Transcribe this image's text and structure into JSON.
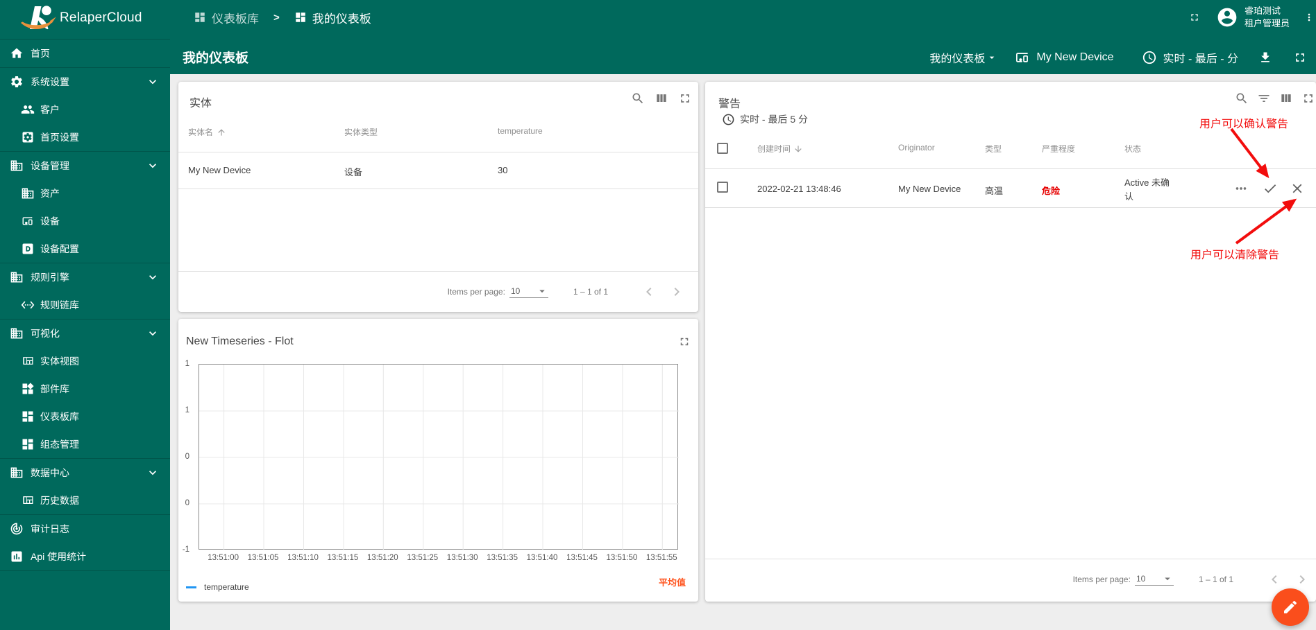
{
  "app": {
    "name": "RelaperCloud"
  },
  "colors": {
    "primary": "#00695C",
    "content_bg": "#EEEEEE",
    "fab_orange": "#FA4E1C",
    "annotation_red": "#F20D0D",
    "severity_red": "#E60000",
    "series_blue": "#2196F3",
    "avg_orange": "#FF5722"
  },
  "breadcrumb": {
    "separator": ">",
    "items": [
      {
        "label": "仪表板库"
      },
      {
        "label": "我的仪表板"
      }
    ]
  },
  "user": {
    "name": "睿珀测试",
    "role": "租户管理员"
  },
  "page_title": "我的仪表板",
  "toolbar": {
    "dashboard_select": "我的仪表板",
    "device_label": "My New Device",
    "timewindow": "实时 - 最后 - 分"
  },
  "sidebar": {
    "items": [
      {
        "label": "首页",
        "icon": "home"
      },
      {
        "label": "系统设置",
        "icon": "settings",
        "expandable": true
      },
      {
        "label": "客户",
        "icon": "people",
        "sub": true
      },
      {
        "label": "首页设置",
        "icon": "settings-applications",
        "sub": true
      },
      {
        "label": "设备管理",
        "icon": "domain",
        "expandable": true
      },
      {
        "label": "资产",
        "icon": "domain",
        "sub": true
      },
      {
        "label": "设备",
        "icon": "devices-other",
        "sub": true
      },
      {
        "label": "设备配置",
        "icon": "alpha-d-box",
        "sub": true
      },
      {
        "label": "规则引擎",
        "icon": "domain",
        "expandable": true
      },
      {
        "label": "规则链库",
        "icon": "settings-ethernet",
        "sub": true
      },
      {
        "label": "可视化",
        "icon": "domain",
        "expandable": true
      },
      {
        "label": "实体视图",
        "icon": "view-quilt",
        "sub": true
      },
      {
        "label": "部件库",
        "icon": "widgets",
        "sub": true
      },
      {
        "label": "仪表板库",
        "icon": "dashboard",
        "sub": true
      },
      {
        "label": "组态管理",
        "icon": "dashboard",
        "sub": true
      },
      {
        "label": "数据中心",
        "icon": "domain",
        "expandable": true
      },
      {
        "label": "历史数据",
        "icon": "view-quilt",
        "sub": true
      },
      {
        "label": "审计日志",
        "icon": "track-changes"
      },
      {
        "label": "Api 使用统计",
        "icon": "insert-chart"
      }
    ]
  },
  "entities": {
    "title": "实体",
    "columns": [
      "实体名",
      "实体类型",
      "temperature"
    ],
    "rows": [
      [
        "My New Device",
        "设备",
        "30"
      ]
    ],
    "paginator": {
      "label": "Items per page:",
      "page_size": "10",
      "range": "1 – 1 of 1"
    }
  },
  "alarms": {
    "title": "警告",
    "timewindow": "实时 - 最后 5 分",
    "columns": [
      "创建时间",
      "Originator",
      "类型",
      "严重程度",
      "状态"
    ],
    "rows": [
      {
        "created_time": "2022-02-21 13:48:46",
        "originator": "My New Device",
        "type": "高温",
        "severity": "危险",
        "status": "Active 未确认"
      }
    ],
    "paginator": {
      "label": "Items per page:",
      "page_size": "10",
      "range": "1 – 1 of 1"
    }
  },
  "annotations": {
    "ack": "用户可以确认警告",
    "clear": "用户可以清除警告"
  },
  "chart_card": {
    "title": "New Timeseries - Flot",
    "avg_label": "平均值",
    "legend": [
      {
        "name": "temperature",
        "color": "#2196F3"
      }
    ]
  },
  "chart_data": {
    "type": "line",
    "title": "New Timeseries - Flot",
    "series": [
      {
        "name": "temperature",
        "color": "#2196F3",
        "values": []
      }
    ],
    "x_ticks": [
      "13:51:00",
      "13:51:05",
      "13:51:10",
      "13:51:15",
      "13:51:20",
      "13:51:25",
      "13:51:30",
      "13:51:35",
      "13:51:40",
      "13:51:45",
      "13:51:50",
      "13:51:55"
    ],
    "y_tick_labels": [
      "1",
      "1",
      "0",
      "0",
      "-1"
    ],
    "ylim": [
      -1,
      1
    ],
    "xlabel": "",
    "ylabel": "",
    "grid": true,
    "legend_position": "bottom-left"
  }
}
